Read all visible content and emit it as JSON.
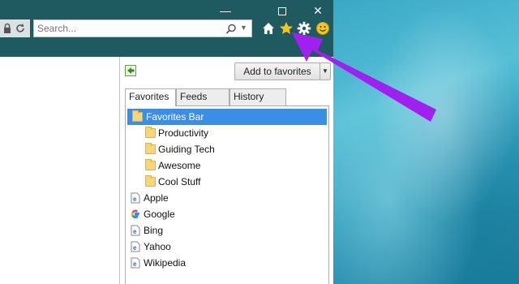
{
  "window": {
    "controls": {
      "minimize": "—",
      "maximize": "",
      "close": "✕"
    }
  },
  "toolbar": {
    "search_placeholder": "Search...",
    "icons": [
      "lock-icon",
      "refresh-icon",
      "search-icon",
      "home-icon",
      "star-icon",
      "gear-icon",
      "smiley-icon"
    ]
  },
  "favorites_panel": {
    "add_button": "Add to favorites",
    "tabs": [
      {
        "label": "Favorites",
        "active": true
      },
      {
        "label": "Feeds",
        "active": false
      },
      {
        "label": "History",
        "active": false
      }
    ],
    "items": [
      {
        "label": "Favorites Bar",
        "type": "folder",
        "selected": true
      },
      {
        "label": "Productivity",
        "type": "folder"
      },
      {
        "label": "Guiding Tech",
        "type": "folder"
      },
      {
        "label": "Awesome",
        "type": "folder"
      },
      {
        "label": "Cool Stuff",
        "type": "folder"
      },
      {
        "label": "Apple",
        "type": "ie-link"
      },
      {
        "label": "Google",
        "type": "google-link"
      },
      {
        "label": "Bing",
        "type": "ie-link"
      },
      {
        "label": "Yahoo",
        "type": "ie-link"
      },
      {
        "label": "Wikipedia",
        "type": "ie-link"
      }
    ]
  },
  "colors": {
    "titlebar": "#1f5a61",
    "selection": "#3a8ee6",
    "star": "#f5c518",
    "annotation_arrow": "#a020f0"
  }
}
